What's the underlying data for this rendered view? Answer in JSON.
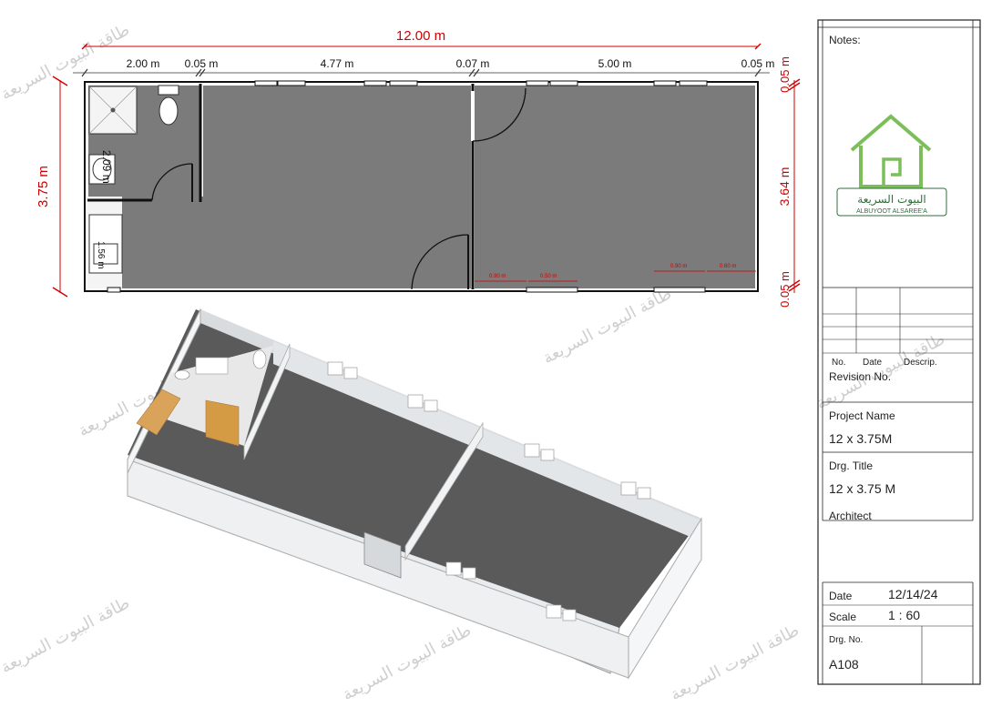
{
  "plan": {
    "overall_width": "12.00 m",
    "segments": [
      "2.00 m",
      "0.05 m",
      "4.77 m",
      "0.07 m",
      "5.00 m",
      "0.05 m"
    ],
    "overall_depth": "3.75 m",
    "right_depth": "3.64 m",
    "right_top": "0.05 m",
    "right_bottom": "0.05 m",
    "bath_depth": "2.09 m",
    "kitchen_depth": "1.56 m",
    "window_dims": [
      "0.90 m",
      "0.50 m",
      "0.90 m",
      "0.60 m"
    ]
  },
  "watermark": "طاقة البيوت السريعة",
  "title_block": {
    "notes_label": "Notes:",
    "logo_arabic": "البيوت السريعة",
    "logo_latin": "ALBUYOOT ALSAREE'A",
    "col_no": "No.",
    "col_date": "Date",
    "col_descrip": "Descrip.",
    "revision_label": "Revision No.",
    "project_name_label": "Project Name",
    "project_name_value": "12 x 3.75M",
    "drg_title_label": "Drg. Title",
    "drg_title_value": "12 x 3.75 M",
    "architect_label": "Architect",
    "date_label": "Date",
    "date_value": "12/14/24",
    "scale_label": "Scale",
    "scale_value": "1 : 60",
    "drg_no_label": "Drg. No.",
    "drg_no_value": "A108"
  },
  "colors": {
    "floor": "#7b7b7b",
    "dimension": "#d10000",
    "logo_green": "#7cbf5a"
  }
}
